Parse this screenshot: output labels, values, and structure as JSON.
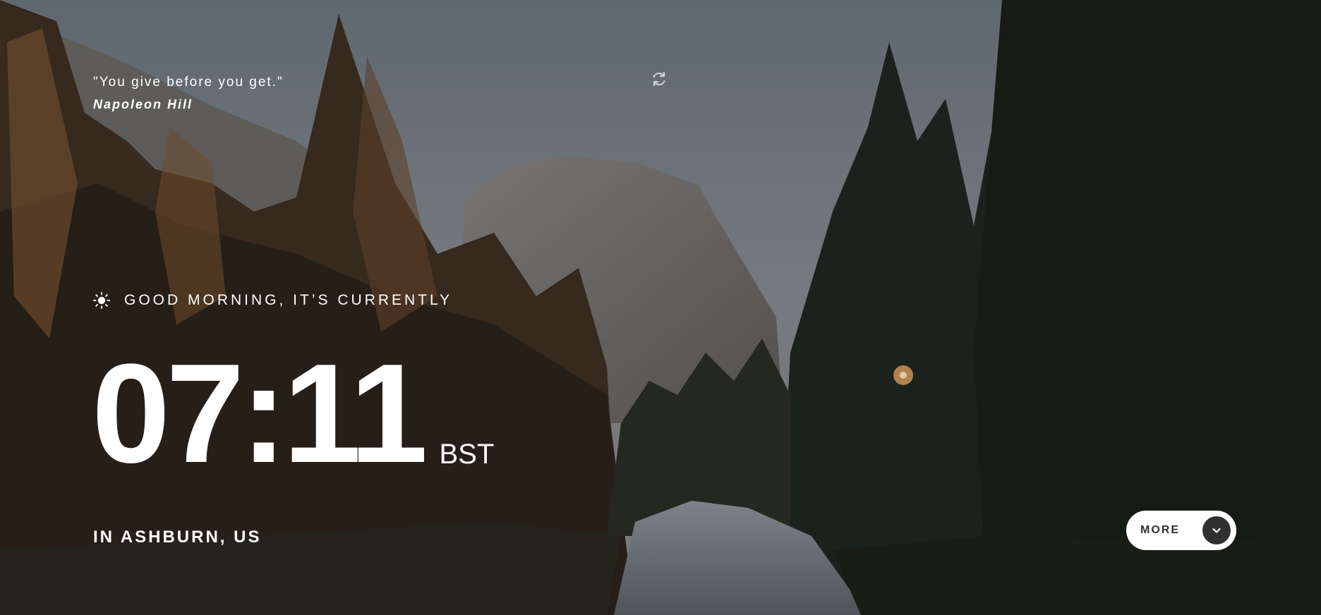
{
  "quote": {
    "text": "\"You give before you get.\"",
    "author": "Napoleon Hill",
    "refresh_icon": "refresh-icon"
  },
  "greeting": {
    "icon": "sun-icon",
    "text": "GOOD MORNING, IT’S CURRENTLY"
  },
  "clock": {
    "time": "07:11",
    "timezone": "BST"
  },
  "location": {
    "text": "IN ASHBURN, US"
  },
  "more_button": {
    "label": "MORE",
    "icon": "chevron-down-icon",
    "background": "#ffffff",
    "icon_background": "#303030"
  }
}
